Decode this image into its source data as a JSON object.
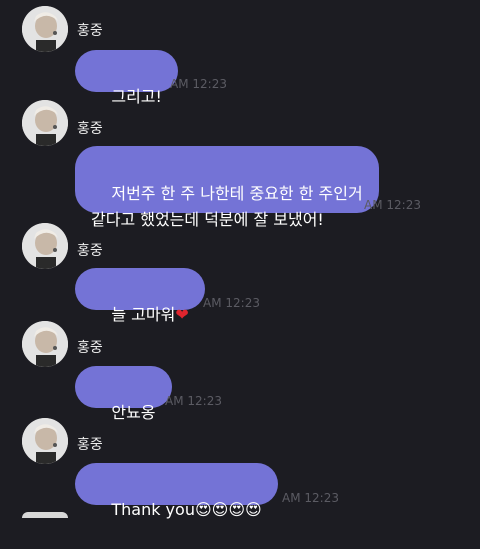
{
  "messages": [
    {
      "sender": "홍중",
      "text": "그리고!",
      "time": "AM 12:23"
    },
    {
      "sender": "홍중",
      "text": "저번주 한 주 나한테 중요한 한 주인거\n같다고 했었는데 덕분에 잘 보냈어!",
      "time": "AM 12:23"
    },
    {
      "sender": "홍중",
      "text": "늘 고마워",
      "emoji": "❤",
      "time": "AM 12:23"
    },
    {
      "sender": "홍중",
      "text": "안뇨옹",
      "time": "AM 12:23"
    },
    {
      "sender": "홍중",
      "text": "Thank you",
      "emoji": "😍😍😍😍",
      "time": "AM 12:23"
    }
  ],
  "colors": {
    "background": "#1c1c22",
    "bubble": "#7473d6",
    "time": "#5b5b63"
  }
}
